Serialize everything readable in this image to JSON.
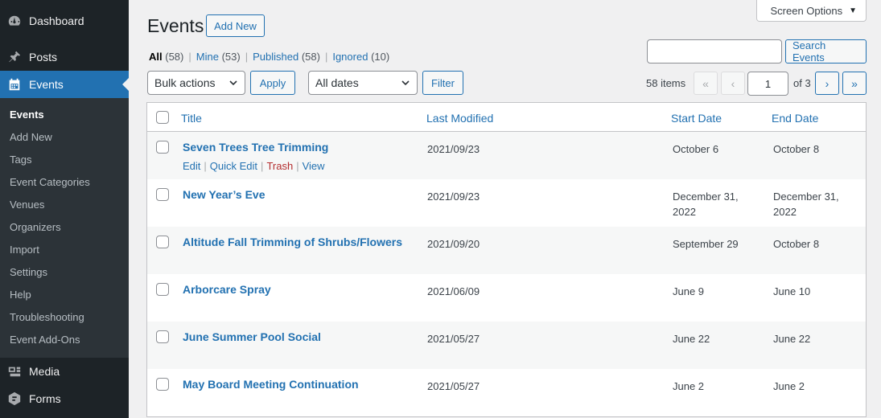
{
  "sidebar": {
    "top_items": [
      {
        "label": "Dashboard",
        "icon": "dashboard-icon"
      },
      {
        "label": "Posts",
        "icon": "pushpin-icon"
      },
      {
        "label": "Events",
        "icon": "calendar-icon"
      }
    ],
    "submenu": [
      "Events",
      "Add New",
      "Tags",
      "Event Categories",
      "Venues",
      "Organizers",
      "Import",
      "Settings",
      "Help",
      "Troubleshooting",
      "Event Add-Ons"
    ],
    "bottom_items": [
      {
        "label": "Media",
        "icon": "media-icon"
      },
      {
        "label": "Forms",
        "icon": "forms-icon"
      }
    ]
  },
  "header": {
    "screen_options": "Screen Options",
    "title": "Events",
    "add_new": "Add New"
  },
  "views": [
    {
      "label": "All",
      "count": "(58)"
    },
    {
      "label": "Mine",
      "count": "(53)"
    },
    {
      "label": "Published",
      "count": "(58)"
    },
    {
      "label": "Ignored",
      "count": "(10)"
    }
  ],
  "search": {
    "button": "Search Events",
    "value": ""
  },
  "toolbar": {
    "bulk_actions": "Bulk actions",
    "apply": "Apply",
    "all_dates": "All dates",
    "filter": "Filter"
  },
  "pagination": {
    "items": "58 items",
    "first": "«",
    "prev": "‹",
    "current_page": "1",
    "of_total": "of 3",
    "next": "›",
    "last": "»"
  },
  "table": {
    "columns": {
      "title": "Title",
      "modified": "Last Modified",
      "start": "Start Date",
      "end": "End Date"
    },
    "row_actions": {
      "edit": "Edit",
      "quick_edit": "Quick Edit",
      "trash": "Trash",
      "view": "View"
    },
    "rows": [
      {
        "title": "Seven Trees Tree Trimming",
        "modified": "2021/09/23",
        "start": "October 6",
        "end": "October 8"
      },
      {
        "title": "New Year’s Eve",
        "modified": "2021/09/23",
        "start": "December 31, 2022",
        "end": "December 31, 2022"
      },
      {
        "title": "Altitude Fall Trimming of Shrubs/Flowers",
        "modified": "2021/09/20",
        "start": "September 29",
        "end": "October 8"
      },
      {
        "title": "Arborcare Spray",
        "modified": "2021/06/09",
        "start": "June 9",
        "end": "June 10"
      },
      {
        "title": "June Summer Pool Social",
        "modified": "2021/05/27",
        "start": "June 22",
        "end": "June 22"
      },
      {
        "title": "May Board Meeting Continuation",
        "modified": "2021/05/27",
        "start": "June 2",
        "end": "June 2"
      }
    ]
  }
}
